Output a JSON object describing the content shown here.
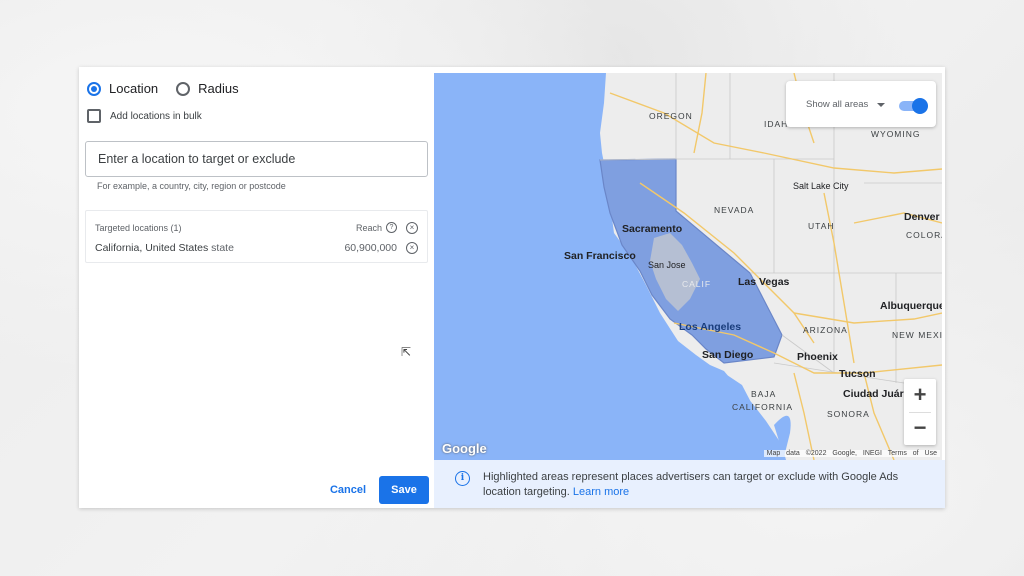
{
  "location_type": {
    "options": [
      {
        "label": "Location",
        "selected": true
      },
      {
        "label": "Radius",
        "selected": false
      }
    ]
  },
  "bulk": {
    "label": "Add locations in bulk",
    "checked": false
  },
  "search": {
    "placeholder": "Enter a location to target or exclude",
    "value": "",
    "hint": "For example, a country, city, region or postcode"
  },
  "targeted": {
    "header": "Targeted locations (1)",
    "reach_label": "Reach",
    "items": [
      {
        "name": "California, United States",
        "type": "state",
        "reach": "60,900,000"
      }
    ]
  },
  "map": {
    "toggle_label": "Show all areas",
    "toggle_on": true,
    "region_labels": [
      "OREGON",
      "IDAH",
      "WYOMING",
      "NEVADA",
      "UTAH",
      "COLORA",
      "ARIZONA",
      "NEW MEXIC",
      "CALIF",
      "BAJA",
      "CALIFORNIA",
      "SONORA"
    ],
    "cities": [
      "Salt Lake City",
      "Denver",
      "Sacramento",
      "San Francisco",
      "San Jose",
      "Las Vegas",
      "Albuquerque",
      "Los Angeles",
      "San Diego",
      "Phoenix",
      "Tucson",
      "Ciudad Juáre"
    ],
    "logo": "Google",
    "attribution": "Map data ©2022 Google, INEGI",
    "terms": "Terms of Use",
    "zoom_in": "+",
    "zoom_out": "−",
    "highlight_color": "#8ab4f8",
    "state_color": "#7f9fe0"
  },
  "info": {
    "text": "Highlighted areas represent places advertisers can target or exclude with Google Ads location targeting.",
    "link": "Learn more"
  },
  "actions": {
    "cancel": "Cancel",
    "save": "Save"
  }
}
